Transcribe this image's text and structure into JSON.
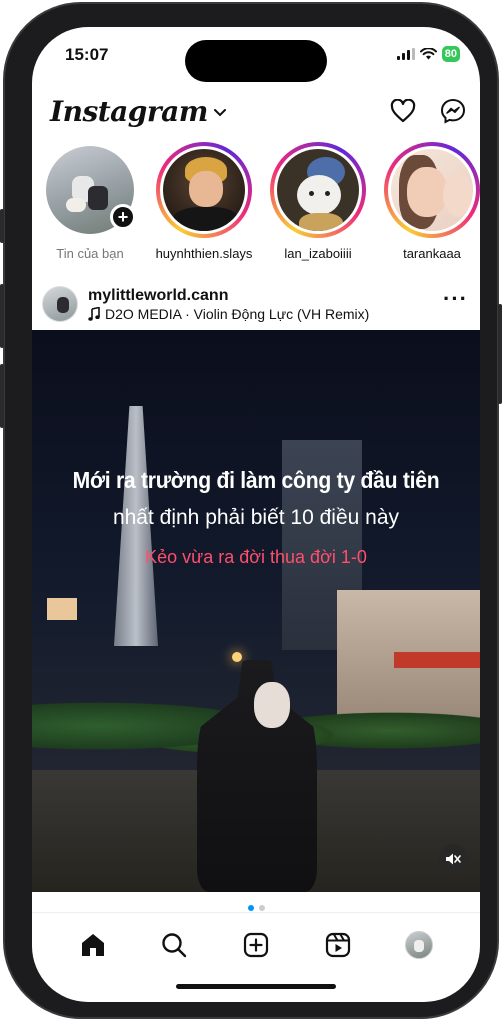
{
  "status": {
    "time": "15:07",
    "battery": "80"
  },
  "header": {
    "logo": "Instagram"
  },
  "stories": [
    {
      "label": "Tin của bạn",
      "own": true
    },
    {
      "label": "huynhthien.slays"
    },
    {
      "label": "lan_izaboiiii"
    },
    {
      "label": "tarankaaa"
    }
  ],
  "post": {
    "username": "mylittleworld.cann",
    "music": "D2O MEDIA · Violin Động Lực (VH Remix)",
    "overlay_line1": "Mới ra trường đi làm công ty đầu tiên",
    "overlay_line2": "nhất định phải biết 10 điều này",
    "overlay_line3": "Kẻo vừa ra đời thua đời 1-0",
    "carousel_active_index": 0,
    "carousel_count": 2
  },
  "colors": {
    "story_ring": [
      "#f9ce34",
      "#ee2a7b",
      "#6228d7"
    ],
    "pager_active": "#0095f6",
    "overlay_accent": "#ff4f6d",
    "battery": "#34c759"
  },
  "icons": {
    "header": [
      "chevron-down-icon",
      "heart-icon",
      "messenger-icon"
    ],
    "tabs": [
      "home-icon",
      "search-icon",
      "create-post-icon",
      "reels-icon",
      "profile-avatar"
    ]
  }
}
